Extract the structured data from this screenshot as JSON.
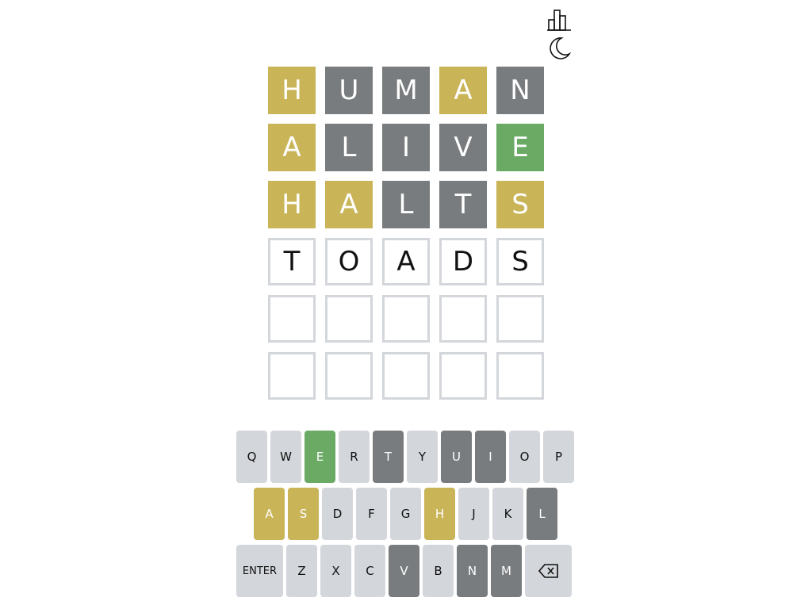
{
  "header": {
    "icons": [
      "stats-icon",
      "dark-mode-icon"
    ]
  },
  "colors": {
    "correct": "#6aaa64",
    "present": "#c9b458",
    "absent": "#787c7e",
    "empty_border": "#d3d6da",
    "key": "#d3d6da"
  },
  "board": {
    "rows": [
      [
        {
          "letter": "H",
          "state": "present"
        },
        {
          "letter": "U",
          "state": "absent"
        },
        {
          "letter": "M",
          "state": "absent"
        },
        {
          "letter": "A",
          "state": "present"
        },
        {
          "letter": "N",
          "state": "absent"
        }
      ],
      [
        {
          "letter": "A",
          "state": "present"
        },
        {
          "letter": "L",
          "state": "absent"
        },
        {
          "letter": "I",
          "state": "absent"
        },
        {
          "letter": "V",
          "state": "absent"
        },
        {
          "letter": "E",
          "state": "correct"
        }
      ],
      [
        {
          "letter": "H",
          "state": "present"
        },
        {
          "letter": "A",
          "state": "present"
        },
        {
          "letter": "L",
          "state": "absent"
        },
        {
          "letter": "T",
          "state": "absent"
        },
        {
          "letter": "S",
          "state": "present"
        }
      ],
      [
        {
          "letter": "T",
          "state": "filled"
        },
        {
          "letter": "O",
          "state": "filled"
        },
        {
          "letter": "A",
          "state": "filled"
        },
        {
          "letter": "D",
          "state": "filled"
        },
        {
          "letter": "S",
          "state": "filled"
        }
      ],
      [
        {
          "letter": "",
          "state": "empty"
        },
        {
          "letter": "",
          "state": "empty"
        },
        {
          "letter": "",
          "state": "empty"
        },
        {
          "letter": "",
          "state": "empty"
        },
        {
          "letter": "",
          "state": "empty"
        }
      ],
      [
        {
          "letter": "",
          "state": "empty"
        },
        {
          "letter": "",
          "state": "empty"
        },
        {
          "letter": "",
          "state": "empty"
        },
        {
          "letter": "",
          "state": "empty"
        },
        {
          "letter": "",
          "state": "empty"
        }
      ]
    ]
  },
  "keyboard": {
    "rows": [
      [
        {
          "label": "Q",
          "state": "unused"
        },
        {
          "label": "W",
          "state": "unused"
        },
        {
          "label": "E",
          "state": "correct"
        },
        {
          "label": "R",
          "state": "unused"
        },
        {
          "label": "T",
          "state": "absent"
        },
        {
          "label": "Y",
          "state": "unused"
        },
        {
          "label": "U",
          "state": "absent"
        },
        {
          "label": "I",
          "state": "absent"
        },
        {
          "label": "O",
          "state": "unused"
        },
        {
          "label": "P",
          "state": "unused"
        }
      ],
      [
        {
          "label": "A",
          "state": "present"
        },
        {
          "label": "S",
          "state": "present"
        },
        {
          "label": "D",
          "state": "unused"
        },
        {
          "label": "F",
          "state": "unused"
        },
        {
          "label": "G",
          "state": "unused"
        },
        {
          "label": "H",
          "state": "present"
        },
        {
          "label": "J",
          "state": "unused"
        },
        {
          "label": "K",
          "state": "unused"
        },
        {
          "label": "L",
          "state": "absent"
        }
      ],
      [
        {
          "label": "ENTER",
          "state": "unused",
          "kind": "enter"
        },
        {
          "label": "Z",
          "state": "unused"
        },
        {
          "label": "X",
          "state": "unused"
        },
        {
          "label": "C",
          "state": "unused"
        },
        {
          "label": "V",
          "state": "absent"
        },
        {
          "label": "B",
          "state": "unused"
        },
        {
          "label": "N",
          "state": "absent"
        },
        {
          "label": "M",
          "state": "absent"
        },
        {
          "label": "",
          "state": "unused",
          "kind": "backspace",
          "icon": "backspace-icon"
        }
      ]
    ]
  }
}
